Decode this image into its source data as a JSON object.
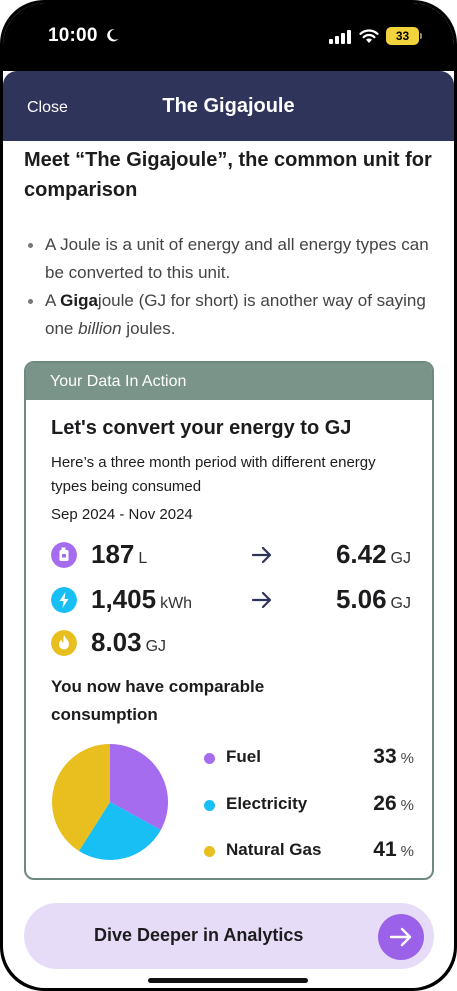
{
  "status_bar": {
    "time": "10:00",
    "battery": "33"
  },
  "nav": {
    "close_label": "Close",
    "title": "The Gigajoule"
  },
  "intro": {
    "headline": "Meet “The Gigajoule”, the common unit for comparison",
    "bullet1": "A Joule is a unit of energy and all energy types can be converted to this unit.",
    "bullet2_pre": "A ",
    "bullet2_bold": "Giga",
    "bullet2_mid": "joule (GJ for short) is another way of saying one ",
    "bullet2_italic": "billion",
    "bullet2_post": " joules."
  },
  "card": {
    "header": "Your Data In Action",
    "title": "Let's convert your energy to GJ",
    "description": "Here’s a three month period with different energy types being consumed",
    "period": "Sep 2024 - Nov 2024",
    "rows": [
      {
        "icon": "fuel-can-icon",
        "value": "187",
        "unit": "L",
        "converted": "6.42",
        "converted_unit": "GJ"
      },
      {
        "icon": "electricity-bolt-icon",
        "value": "1,405",
        "unit": "kWh",
        "converted": "5.06",
        "converted_unit": "GJ"
      },
      {
        "icon": "gas-flame-icon",
        "value": "8.03",
        "unit": "GJ"
      }
    ],
    "comparable_pre": "You now have ",
    "comparable_bold": "comparable",
    "comparable_post": " consumption"
  },
  "chart_data": {
    "type": "pie",
    "categories": [
      "Fuel",
      "Electricity",
      "Natural Gas"
    ],
    "values": [
      33,
      26,
      41
    ],
    "unit": "%",
    "colors": [
      "#a66cf0",
      "#17bff5",
      "#e8bf1e"
    ]
  },
  "colors": {
    "fuel": "#a66cf0",
    "electricity": "#17bff5",
    "gas": "#e8bf1e",
    "header": "#2f345a",
    "card_accent": "#7a948a"
  },
  "cta": {
    "label": "Dive Deeper in Analytics"
  }
}
